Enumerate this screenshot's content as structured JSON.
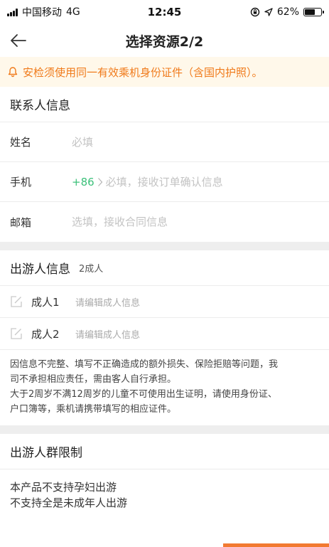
{
  "status_bar": {
    "carrier": "中国移动",
    "network": "4G",
    "time": "12:45",
    "battery_text": "62%",
    "battery_level": 0.62
  },
  "nav": {
    "title": "选择资源2/2",
    "back_icon": "arrow-left-icon"
  },
  "notice": {
    "icon": "bell-icon",
    "text": "安检须使用同一有效乘机身份证件（含国内护照）。"
  },
  "contact": {
    "title": "联系人信息",
    "name_label": "姓名",
    "name_placeholder": "必填",
    "phone_label": "手机",
    "country_code": "+86",
    "phone_placeholder": "必填，接收订单确认信息",
    "email_label": "邮箱",
    "email_placeholder": "选填，接收合同信息"
  },
  "travelers": {
    "title": "出游人信息",
    "count": "2成人",
    "items": [
      {
        "label": "成人1",
        "hint": "请编辑成人信息"
      },
      {
        "label": "成人2",
        "hint": "请编辑成人信息"
      }
    ],
    "disclaimer_lines": [
      "因信息不完整、填写不正确造成的额外损失、保险拒赔等问题，我",
      "司不承担相应责任，需由客人自行承担。",
      "大于2周岁不满12周岁的儿童不可使用出生证明，请使用身份证、",
      "户口簿等，乘机请携带填写的相应证件。"
    ]
  },
  "restrictions": {
    "title": "出游人群限制",
    "lines": [
      "本产品不支持孕妇出游",
      "不支持全是未成年人出游"
    ]
  },
  "colors": {
    "accent_orange": "#f07a1a",
    "notice_bg": "#fff8ea",
    "green": "#3cc07a"
  }
}
